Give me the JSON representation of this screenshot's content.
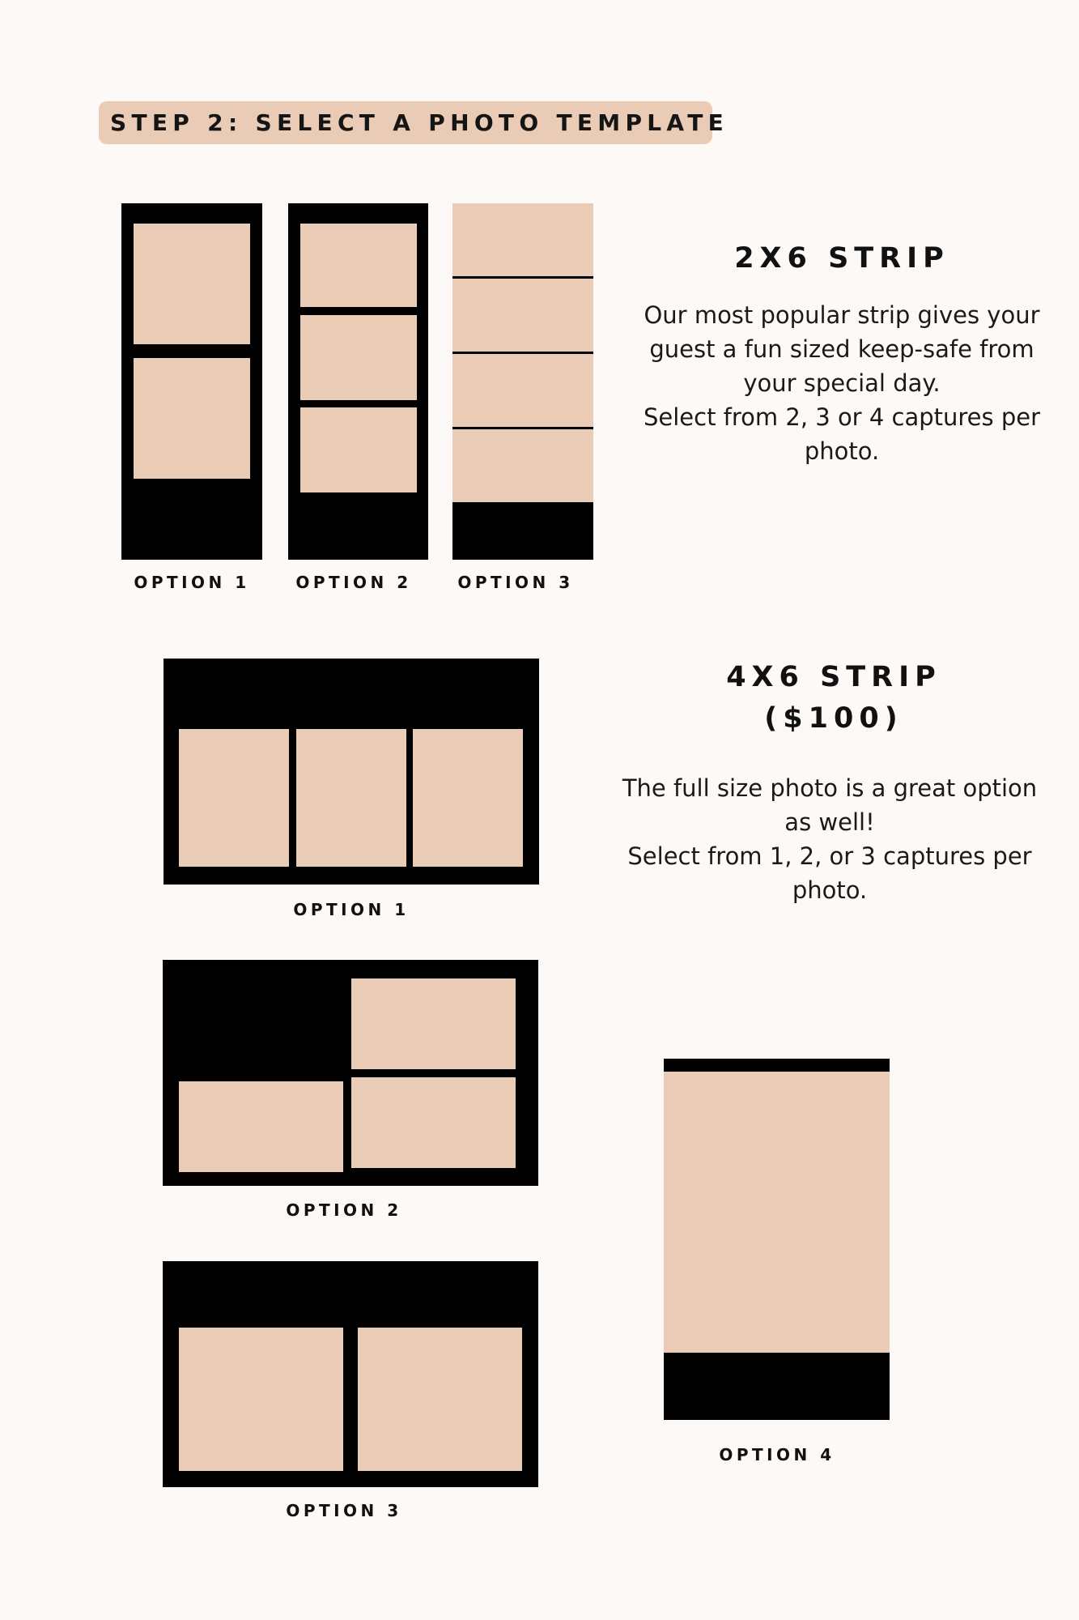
{
  "header": {
    "step_label": "STEP 2: SELECT A PHOTO TEMPLATE"
  },
  "strip_2x6": {
    "title": "2X6 STRIP",
    "description_lines": [
      "Our most popular strip gives your",
      "guest a fun sized keep-safe from",
      "your special day.",
      "Select from 2, 3 or 4 captures per",
      "photo."
    ],
    "options": [
      {
        "label": "OPTION 1",
        "captures": 2
      },
      {
        "label": "OPTION 2",
        "captures": 3
      },
      {
        "label": "OPTION 3",
        "captures": 4
      }
    ]
  },
  "strip_4x6": {
    "title_line1": "4X6 STRIP",
    "title_line2": "($100)",
    "description_lines": [
      "The full size photo is a great option",
      "as well!",
      "Select from 1, 2, or 3 captures per",
      "photo."
    ],
    "options": [
      {
        "label": "OPTION 1",
        "captures": 3
      },
      {
        "label": "OPTION 2",
        "captures": 3
      },
      {
        "label": "OPTION 3",
        "captures": 2
      },
      {
        "label": "OPTION 4",
        "captures": 1
      }
    ]
  },
  "colors": {
    "background": "#fdf9f7",
    "accent": "#eaccb6",
    "frame": "#000000"
  }
}
